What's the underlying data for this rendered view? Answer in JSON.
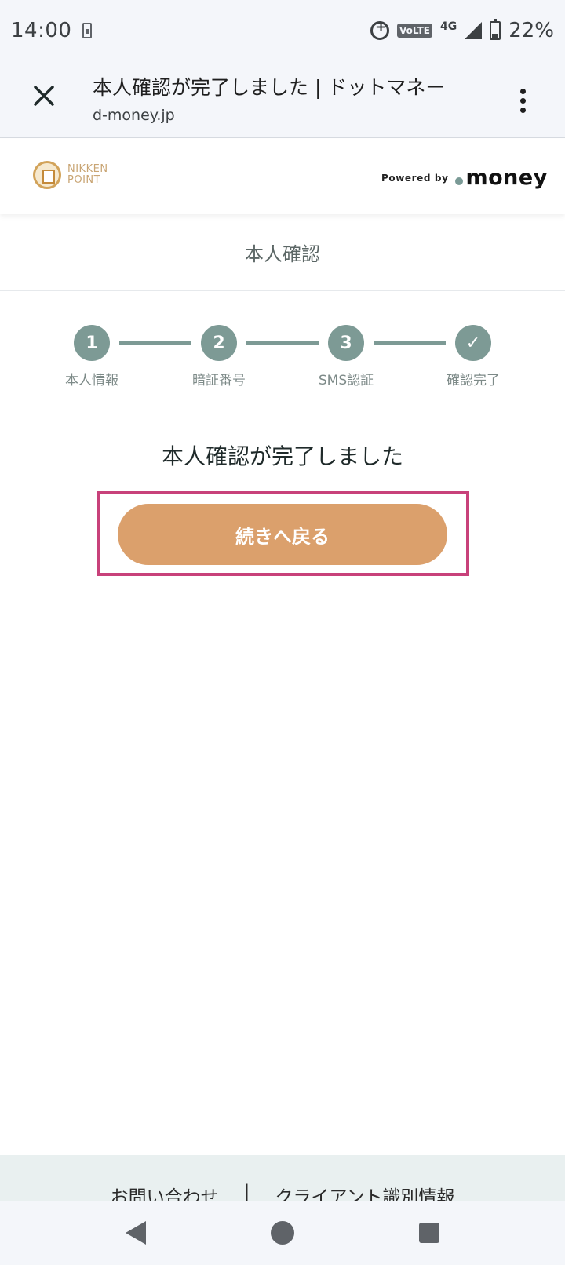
{
  "status_bar": {
    "time": "14:00",
    "network": "4G",
    "volte": "VoLTE",
    "battery": "22%"
  },
  "toolbar": {
    "title": "本人確認が完了しました | ドットマネー",
    "url": "d-money.jp"
  },
  "header": {
    "nikken_line1": "NIKKEN",
    "nikken_line2": "POINT",
    "powered_by": "Powered by",
    "money_brand": "money"
  },
  "page": {
    "heading": "本人確認"
  },
  "steps": [
    {
      "number": "1",
      "label": "本人情報"
    },
    {
      "number": "2",
      "label": "暗証番号"
    },
    {
      "number": "3",
      "label": "SMS認証"
    },
    {
      "number": "✓",
      "label": "確認完了"
    }
  ],
  "main": {
    "complete_message": "本人確認が完了しました",
    "continue_button": "続きへ戻る"
  },
  "footer": {
    "contact": "お問い合わせ",
    "separator": "|",
    "client_info": "クライアント識別情報"
  },
  "colors": {
    "accent": "#7d9a95",
    "button": "#dba06c",
    "highlight": "#c8417a"
  }
}
